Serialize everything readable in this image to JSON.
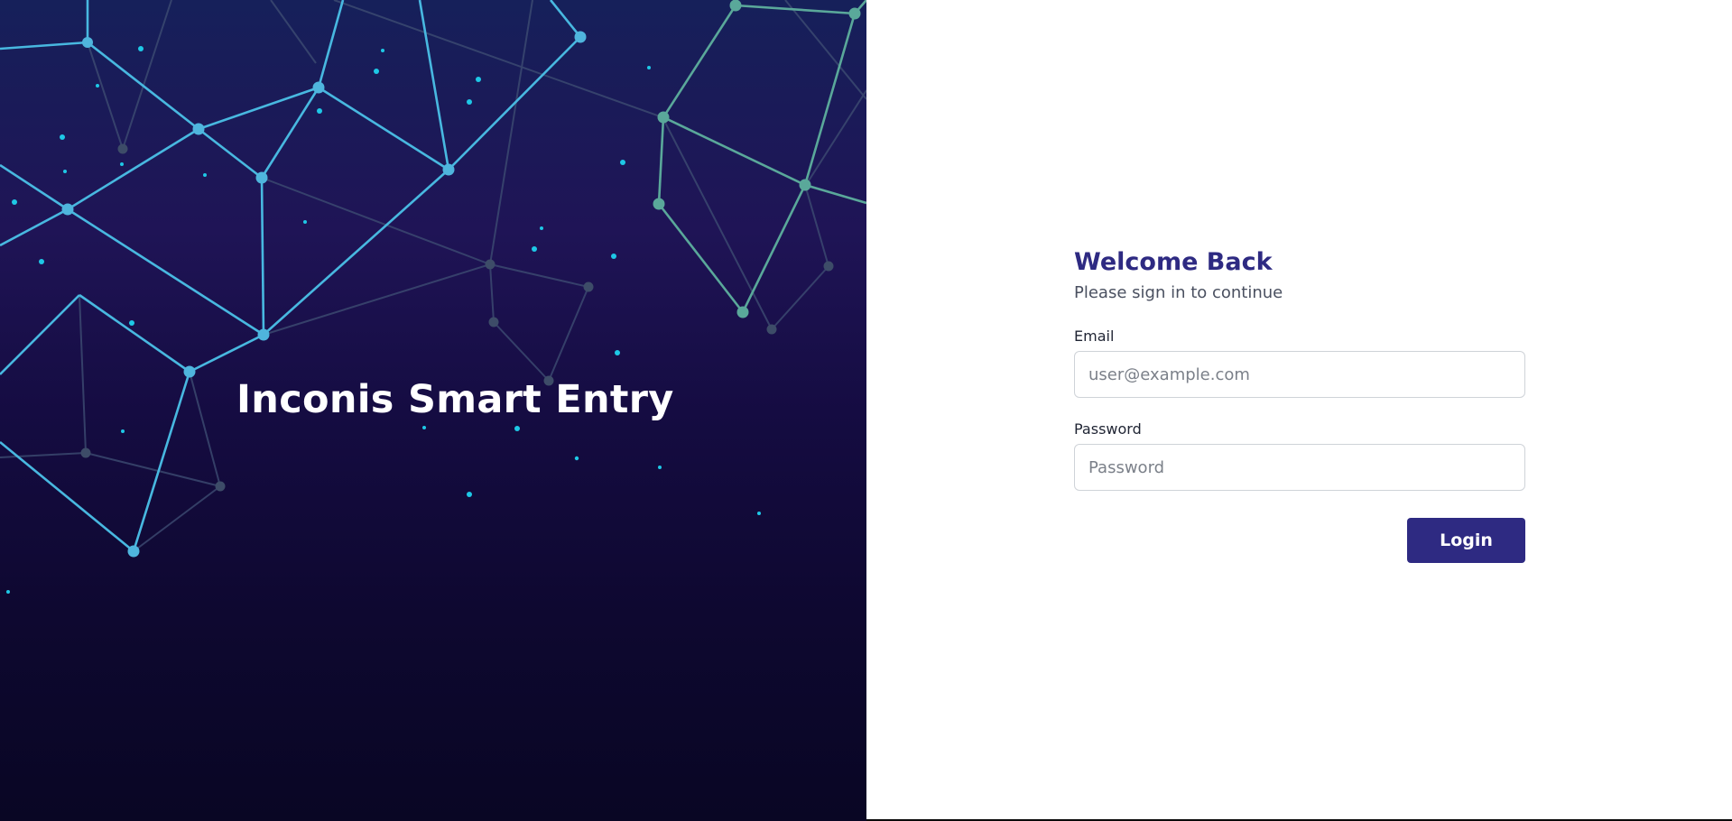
{
  "hero": {
    "title": "Inconis Smart Entry"
  },
  "login": {
    "title": "Welcome Back",
    "subtitle": "Please sign in to continue",
    "email_label": "Email",
    "email_placeholder": "user@example.com",
    "email_value": "",
    "password_label": "Password",
    "password_placeholder": "Password",
    "password_value": "",
    "submit_label": "Login"
  },
  "colors": {
    "brand": "#2e2a82",
    "hero_dark": "#0e0830",
    "network_cyan": "#4fc3f7",
    "network_teal": "#5aa89a",
    "network_dim": "#3a4a68"
  },
  "icons": [
    "network-graph-decoration"
  ]
}
